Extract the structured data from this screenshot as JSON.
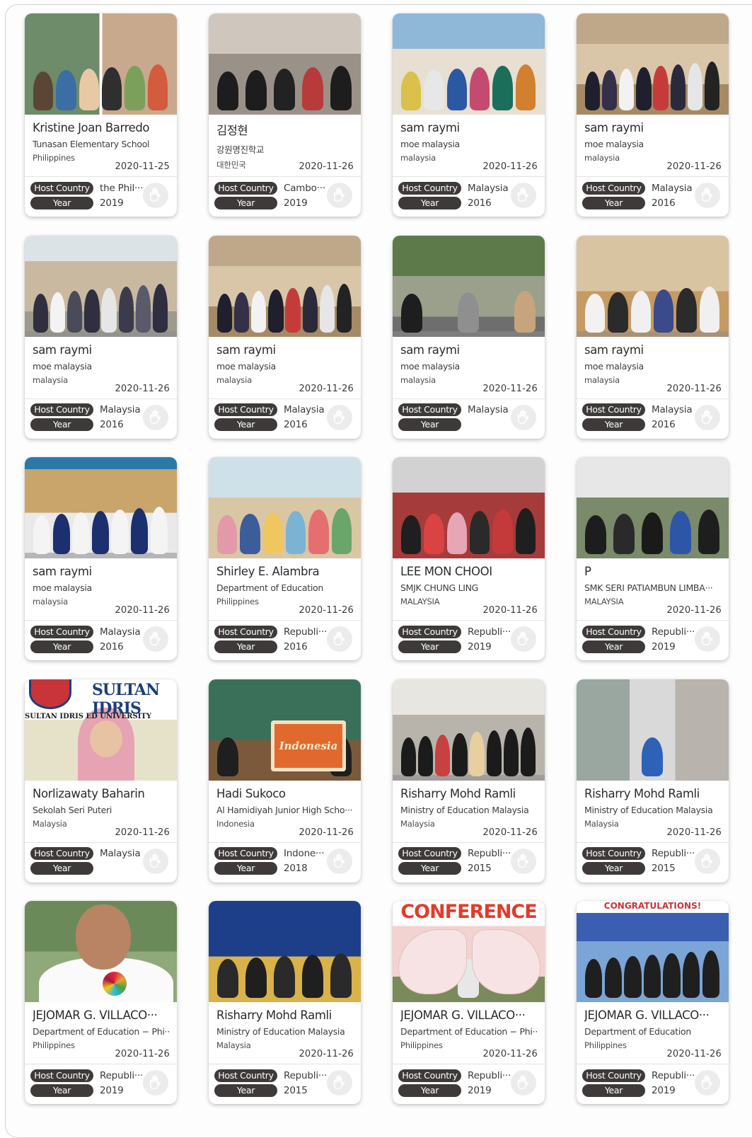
{
  "labels": {
    "host_country": "Host Country",
    "year": "Year"
  },
  "cards": [
    {
      "name": "Kristine Joan Barredo",
      "org": "Tunasan Elementary School",
      "country": "Philippines",
      "date": "2020-11-25",
      "host": "the Phil···",
      "year": "2019",
      "theme": "collage"
    },
    {
      "name": "김정현",
      "org": "강원명진학교",
      "country": "대한민국",
      "date": "2020-11-26",
      "host": "Cambo···",
      "year": "2019",
      "theme": "school"
    },
    {
      "name": "sam raymi",
      "org": "moe malaysia",
      "country": "malaysia",
      "date": "2020-11-26",
      "host": "Malaysia",
      "year": "2016",
      "theme": "conference"
    },
    {
      "name": "sam raymi",
      "org": "moe malaysia",
      "country": "malaysia",
      "date": "2020-11-26",
      "host": "Malaysia",
      "year": "2016",
      "theme": "hall"
    },
    {
      "name": "sam raymi",
      "org": "moe malaysia",
      "country": "malaysia",
      "date": "2020-11-26",
      "host": "Malaysia",
      "year": "2016",
      "theme": "outdoor"
    },
    {
      "name": "sam raymi",
      "org": "moe malaysia",
      "country": "malaysia",
      "date": "2020-11-26",
      "host": "Malaysia",
      "year": "2016",
      "theme": "hall"
    },
    {
      "name": "sam raymi",
      "org": "moe malaysia",
      "country": "malaysia",
      "date": "2020-11-26",
      "host": "Malaysia",
      "year": "",
      "theme": "park"
    },
    {
      "name": "sam raymi",
      "org": "moe malaysia",
      "country": "malaysia",
      "date": "2020-11-26",
      "host": "Malaysia",
      "year": "2016",
      "theme": "gym"
    },
    {
      "name": "sam raymi",
      "org": "moe malaysia",
      "country": "malaysia",
      "date": "2020-11-26",
      "host": "Malaysia",
      "year": "2016",
      "theme": "framed"
    },
    {
      "name": "Shirley E. Alambra",
      "org": "Department of Education",
      "country": "Philippines",
      "date": "2020-11-26",
      "host": "Republi···",
      "year": "2016",
      "theme": "classroom"
    },
    {
      "name": "LEE MON CHOOI",
      "org": "SMJK CHUNG LING",
      "country": "MALAYSIA",
      "date": "2020-11-26",
      "host": "Republi···",
      "year": "2019",
      "theme": "party"
    },
    {
      "name": "P",
      "org": "SMK SERI PATIAMBUN LIMBA···",
      "country": "MALAYSIA",
      "date": "2020-11-26",
      "host": "Republi···",
      "year": "2019",
      "theme": "lab"
    },
    {
      "name": "Norlizawaty Baharin",
      "org": "Sekolah Seri Puteri",
      "country": "Malaysia",
      "date": "2020-11-26",
      "host": "Malaysia",
      "year": "",
      "theme": "portrait",
      "logo_text": "SULTAN IDRIS",
      "uni_text": "SULTAN IDRIS ED       UNIVERSITY"
    },
    {
      "name": "Hadi Sukoco",
      "org": "Al Hamidiyah Junior High Scho···",
      "country": "Indonesia",
      "date": "2020-11-26",
      "host": "Indone···",
      "year": "2018",
      "theme": "indonesia",
      "sign_text": "Indonesia"
    },
    {
      "name": "Risharry Mohd Ramli",
      "org": "Ministry of Education Malaysia",
      "country": "Malaysia",
      "date": "2020-11-26",
      "host": "Republi···",
      "year": "2015",
      "theme": "formal"
    },
    {
      "name": "Risharry Mohd Ramli",
      "org": "Ministry of Education Malaysia",
      "country": "Malaysia",
      "date": "2020-11-26",
      "host": "Republi···",
      "year": "2015",
      "theme": "gate"
    },
    {
      "name": "JEJOMAR G. VILLACO···",
      "org": "Department of Education − Phi···",
      "country": "Philippines",
      "date": "2020-11-26",
      "host": "Republi···",
      "year": "2019",
      "theme": "selfie"
    },
    {
      "name": "Risharry Mohd Ramli",
      "org": "Ministry of Education Malaysia",
      "country": "Malaysia",
      "date": "2020-11-26",
      "host": "Republi···",
      "year": "2015",
      "theme": "flags"
    },
    {
      "name": "JEJOMAR G. VILLACO···",
      "org": "Department of Education − Phi···",
      "country": "Philippines",
      "date": "2020-11-26",
      "host": "Republi···",
      "year": "2019",
      "theme": "wings",
      "banner_text": "CONFERENCE"
    },
    {
      "name": "JEJOMAR G. VILLACO···",
      "org": "Department of Education",
      "country": "Philippines",
      "date": "2020-11-26",
      "host": "Republi···",
      "year": "2019",
      "theme": "poster",
      "banner_text": "CONGRATULATIONS!"
    }
  ]
}
